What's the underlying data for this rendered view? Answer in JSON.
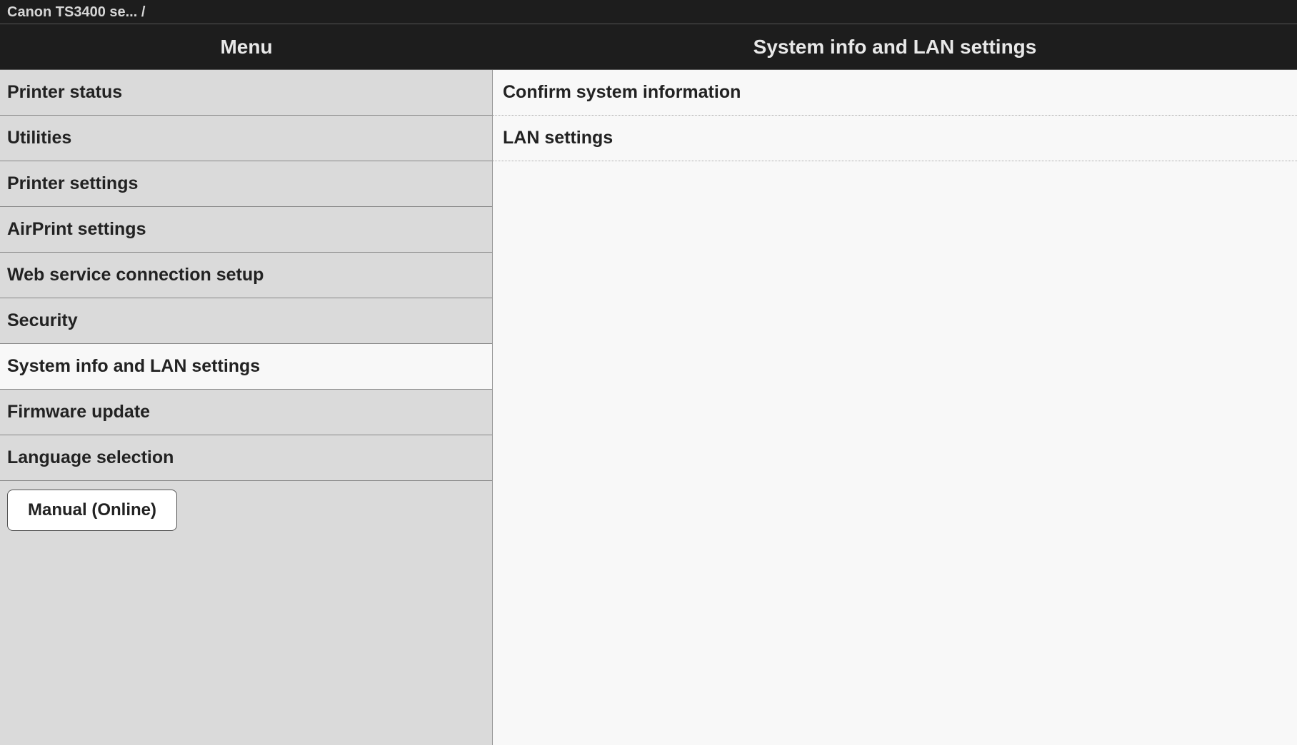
{
  "breadcrumb": "Canon TS3400 se... /",
  "header": {
    "menu_title": "Menu",
    "detail_title": "System info and LAN settings"
  },
  "menu": {
    "items": [
      {
        "label": "Printer status",
        "selected": false
      },
      {
        "label": "Utilities",
        "selected": false
      },
      {
        "label": "Printer settings",
        "selected": false
      },
      {
        "label": "AirPrint settings",
        "selected": false
      },
      {
        "label": "Web service connection setup",
        "selected": false
      },
      {
        "label": "Security",
        "selected": false
      },
      {
        "label": "System info and LAN settings",
        "selected": true
      },
      {
        "label": "Firmware update",
        "selected": false
      },
      {
        "label": "Language selection",
        "selected": false
      }
    ],
    "manual_button": "Manual (Online)"
  },
  "detail": {
    "items": [
      {
        "label": "Confirm system information"
      },
      {
        "label": "LAN settings"
      }
    ]
  }
}
